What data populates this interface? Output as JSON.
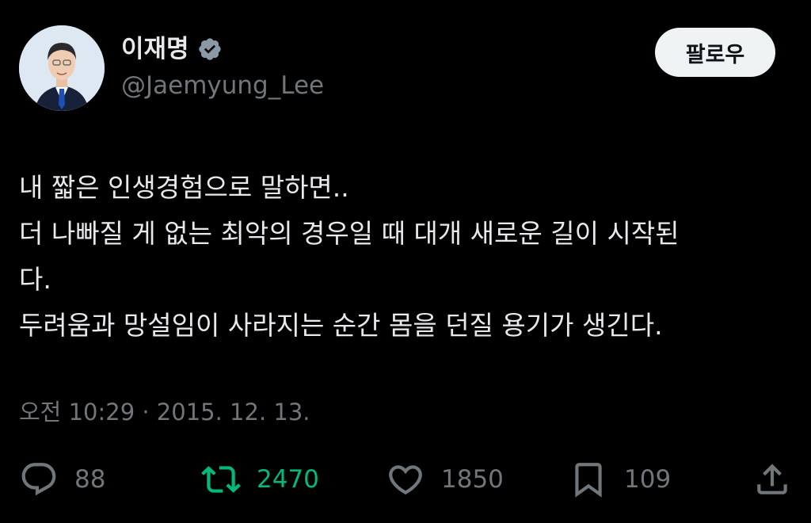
{
  "author": {
    "display_name": "이재명",
    "handle": "@Jaemyung_Lee",
    "verified": true,
    "avatar": "avatar-photo"
  },
  "follow_button": {
    "label": "팔로우"
  },
  "tweet": {
    "lines": [
      "내 짧은 인생경험으로 말하면..",
      "더 나빠질 게 없는 최악의 경우일 때 대개 새로운 길이 시작된",
      "다.",
      "두려움과 망설임이 사라지는 순간 몸을 던질 용기가 생긴다."
    ],
    "timestamp": "오전 10:29 · 2015. 12. 13."
  },
  "actions": {
    "reply": {
      "icon": "reply-icon",
      "count": "88"
    },
    "retweet": {
      "icon": "retweet-icon",
      "count": "2470",
      "color": "#00ba7c"
    },
    "like": {
      "icon": "heart-icon",
      "count": "1850"
    },
    "bookmark": {
      "icon": "bookmark-icon",
      "count": "109"
    },
    "share": {
      "icon": "share-icon"
    }
  },
  "colors": {
    "background": "#000000",
    "text": "#e7e9ea",
    "secondary": "#71767b",
    "retweet_active": "#00ba7c",
    "button_bg": "#eff3f4"
  }
}
